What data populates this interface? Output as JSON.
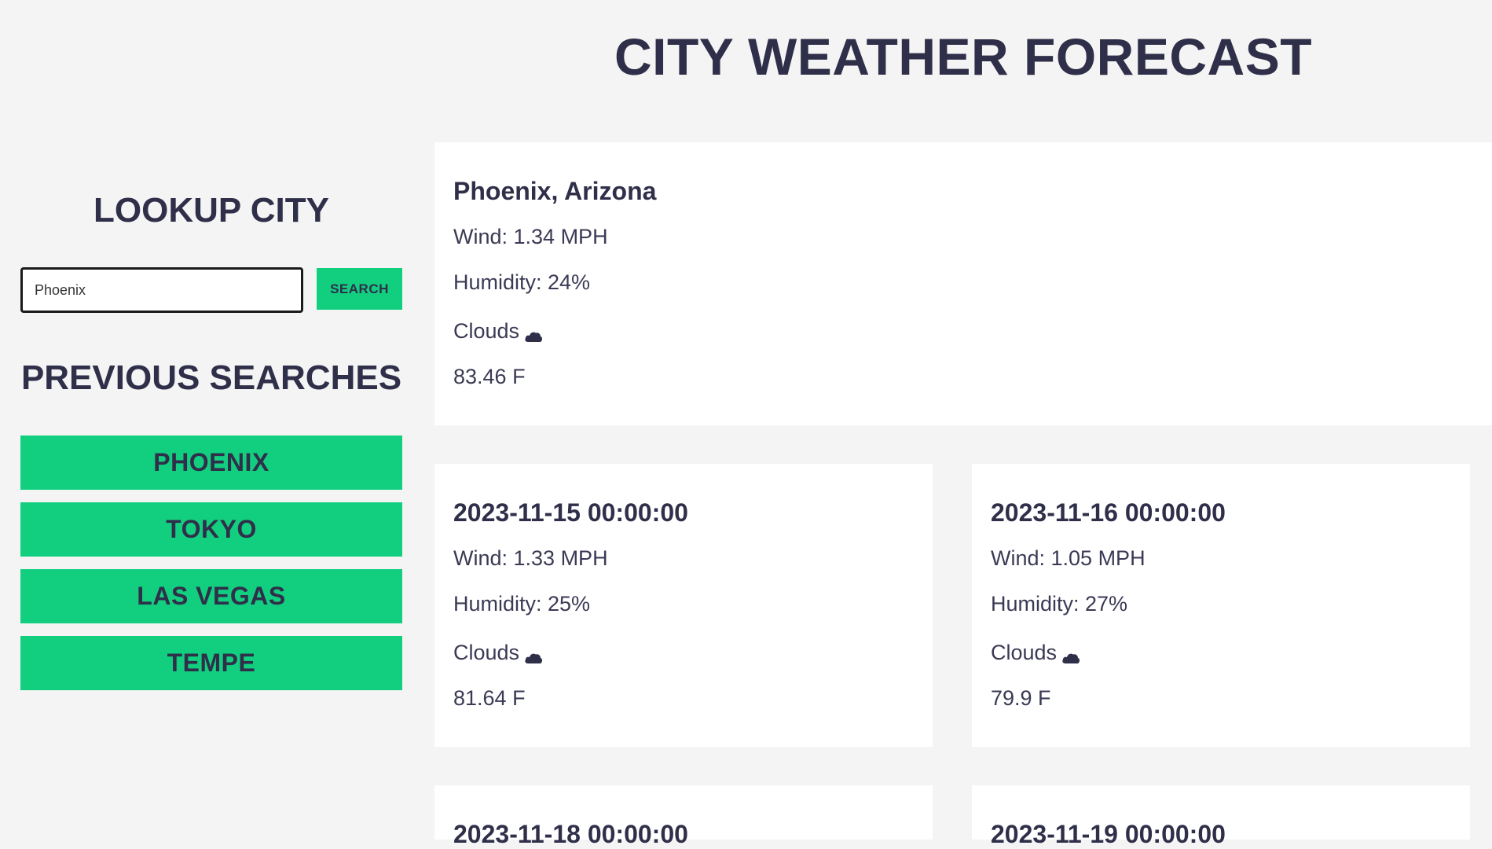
{
  "header": {
    "title": "CITY WEATHER FORECAST"
  },
  "sidebar": {
    "lookup_title": "LOOKUP CITY",
    "search": {
      "value": "Phoenix",
      "placeholder": "",
      "button_label": "SEARCH"
    },
    "previous_title": "PREVIOUS SEARCHES",
    "history": [
      "PHOENIX",
      "TOKYO",
      "LAS VEGAS",
      "TEMPE"
    ]
  },
  "current": {
    "title": "Phoenix, Arizona",
    "wind": "Wind: 1.34 MPH",
    "humidity": "Humidity: 24%",
    "conditions": "Clouds",
    "conditions_icon": "cloud-icon",
    "temp": "83.46 F"
  },
  "forecast": [
    {
      "date": "2023-11-15 00:00:00",
      "wind": "Wind: 1.33 MPH",
      "humidity": "Humidity: 25%",
      "conditions": "Clouds",
      "temp": "81.64 F"
    },
    {
      "date": "2023-11-16 00:00:00",
      "wind": "Wind: 1.05 MPH",
      "humidity": "Humidity: 27%",
      "conditions": "Clouds",
      "temp": "79.9 F"
    },
    {
      "date": "2023-11-18 00:00:00"
    },
    {
      "date": "2023-11-19 00:00:00"
    }
  ],
  "colors": {
    "accent": "#12cf80",
    "text": "#2f2f4a",
    "background": "#f4f4f4",
    "card": "#ffffff"
  }
}
